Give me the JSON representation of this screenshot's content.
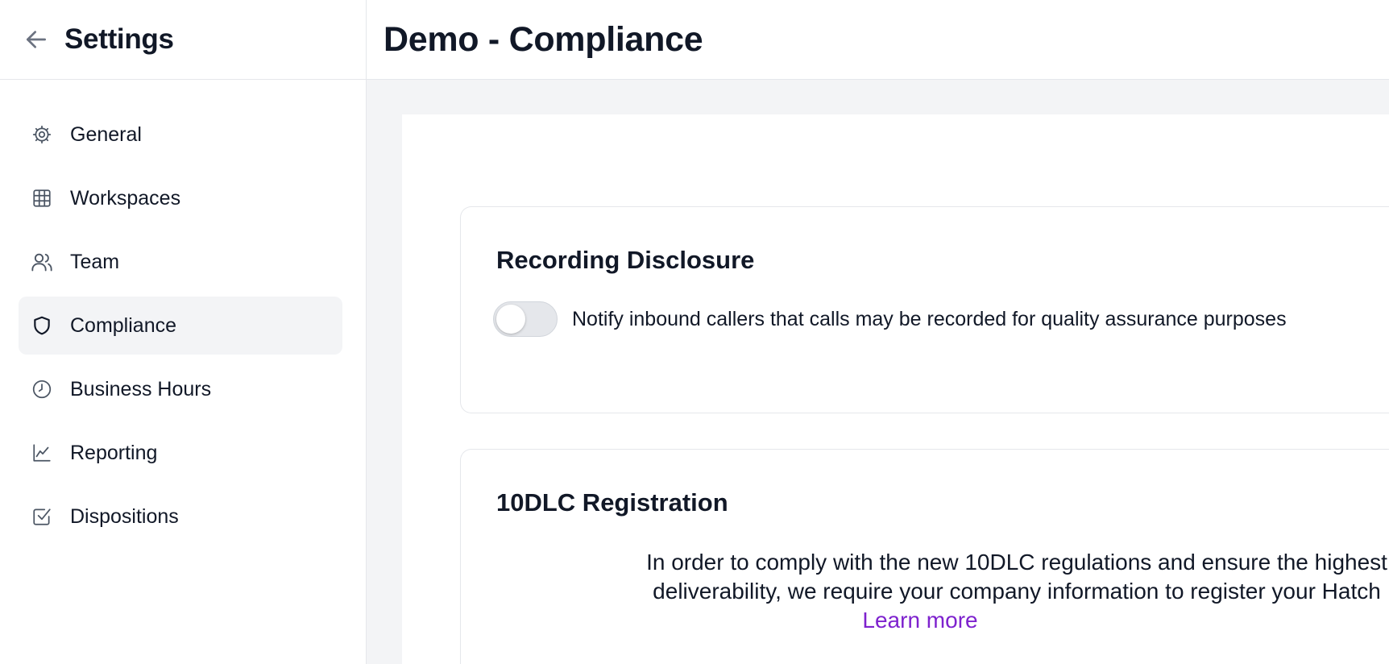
{
  "sidebar": {
    "title": "Settings",
    "items": [
      {
        "label": "General",
        "icon": "gear-icon"
      },
      {
        "label": "Workspaces",
        "icon": "grid-icon"
      },
      {
        "label": "Team",
        "icon": "users-icon"
      },
      {
        "label": "Compliance",
        "icon": "shield-icon",
        "active": true
      },
      {
        "label": "Business Hours",
        "icon": "clock-icon"
      },
      {
        "label": "Reporting",
        "icon": "chart-line-icon"
      },
      {
        "label": "Dispositions",
        "icon": "checkbox-icon"
      }
    ]
  },
  "header": {
    "title": "Demo - Compliance"
  },
  "recording": {
    "title": "Recording Disclosure",
    "toggle_on": false,
    "toggle_label": "Notify inbound callers that calls may be recorded for quality assurance purposes"
  },
  "dlc": {
    "title": "10DLC Registration",
    "line1": "In order to comply with the new 10DLC regulations and ensure the highest",
    "line2": "deliverability, we require your company information to register your Hatch",
    "learn_more": "Learn more"
  },
  "colors": {
    "accent": "#7e22ce",
    "active_bg": "#f3f4f6",
    "content_bg": "#f3f4f6",
    "border": "#e5e7eb"
  }
}
